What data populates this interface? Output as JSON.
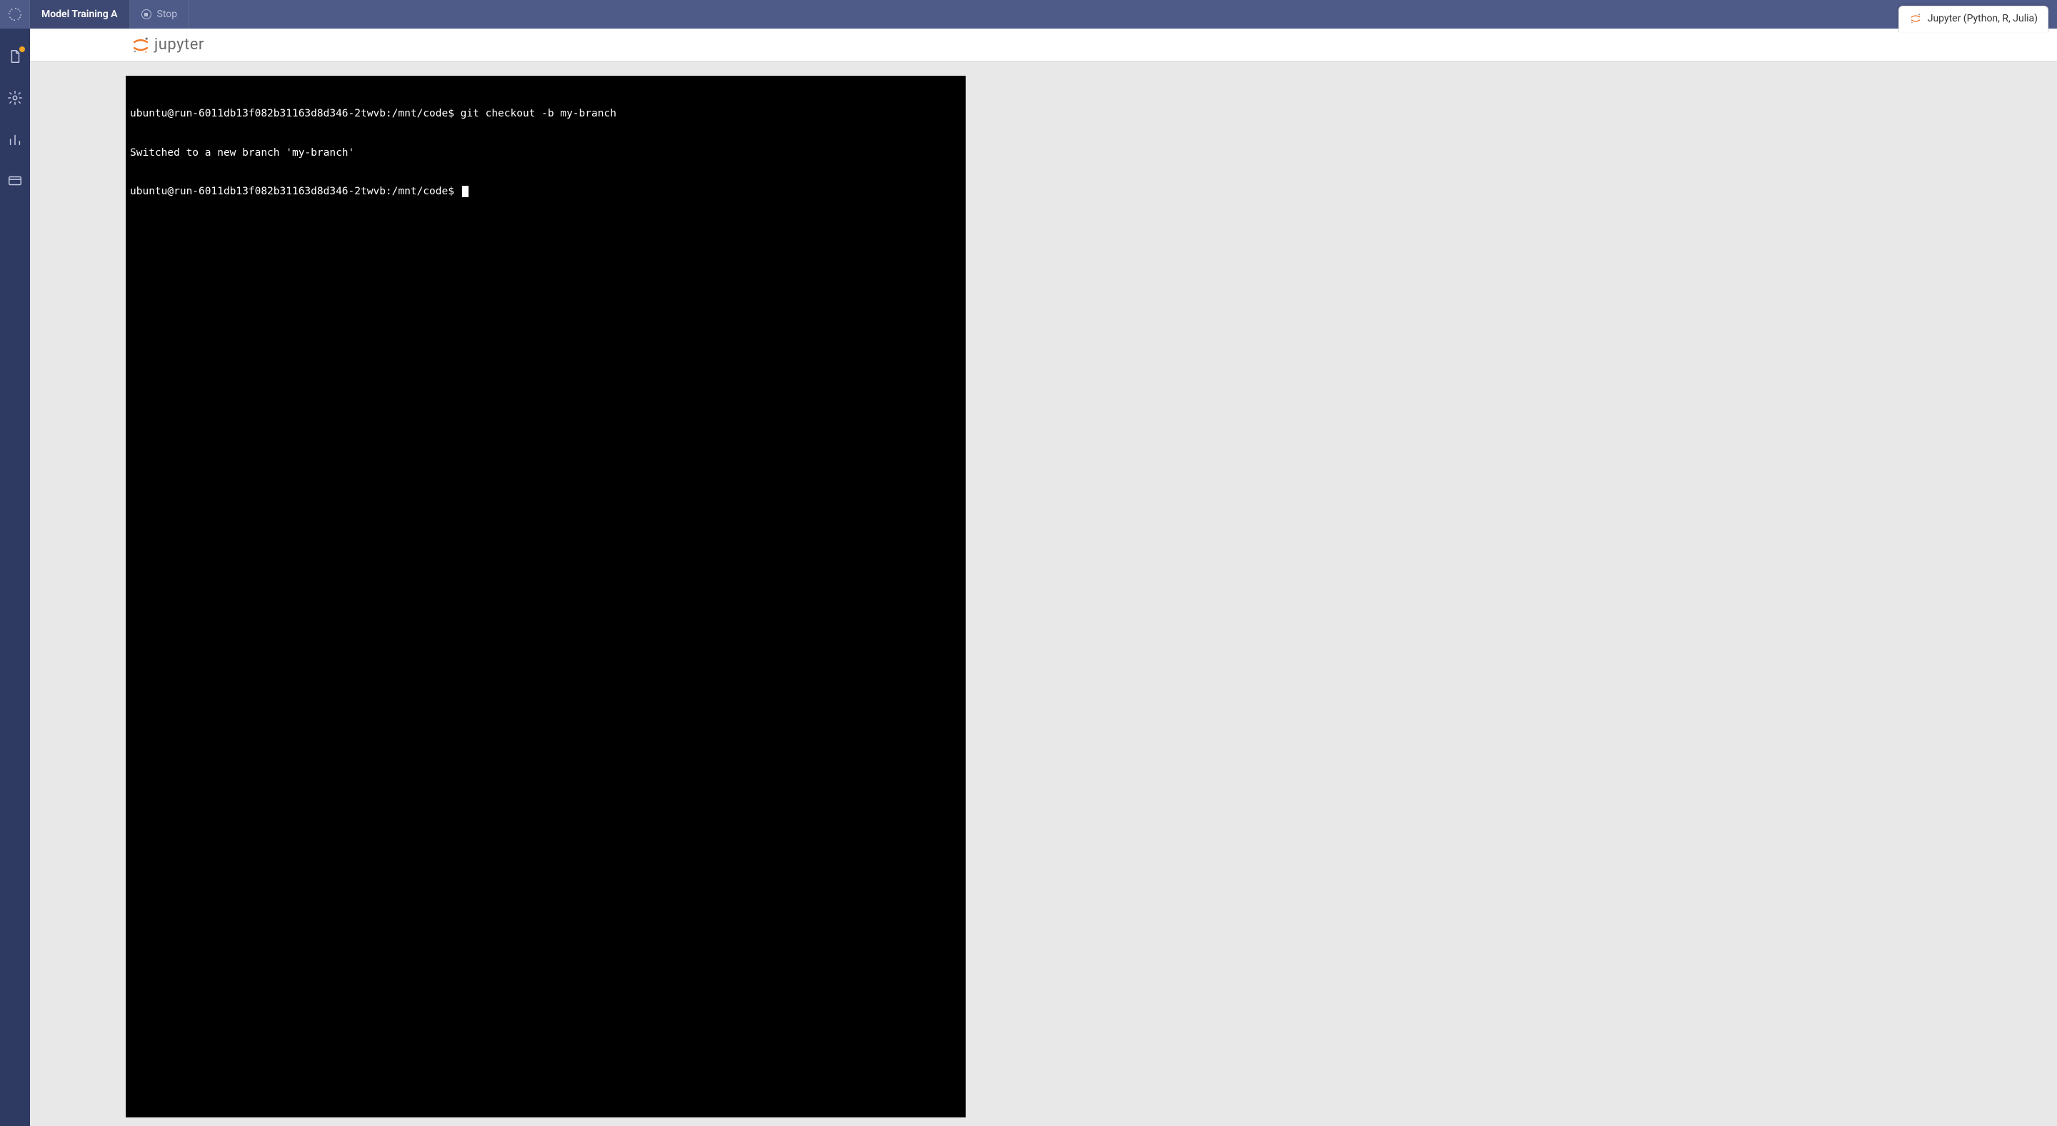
{
  "topbar": {
    "title": "Model Training A",
    "stop_label": "Stop",
    "active_tab_label": "Jupyter (Python, R, Julia)"
  },
  "jupyter_header": {
    "brand_text": "jupyter"
  },
  "sidebar": {
    "items": [
      {
        "name": "files",
        "has_badge": true
      },
      {
        "name": "settings",
        "has_badge": false
      },
      {
        "name": "metrics",
        "has_badge": false
      },
      {
        "name": "card",
        "has_badge": false
      }
    ]
  },
  "terminal": {
    "lines": [
      "ubuntu@run-6011db13f082b31163d8d346-2twvb:/mnt/code$ git checkout -b my-branch",
      "Switched to a new branch 'my-branch'",
      "ubuntu@run-6011db13f082b31163d8d346-2twvb:/mnt/code$ "
    ],
    "cursor_on_last_line": true
  }
}
